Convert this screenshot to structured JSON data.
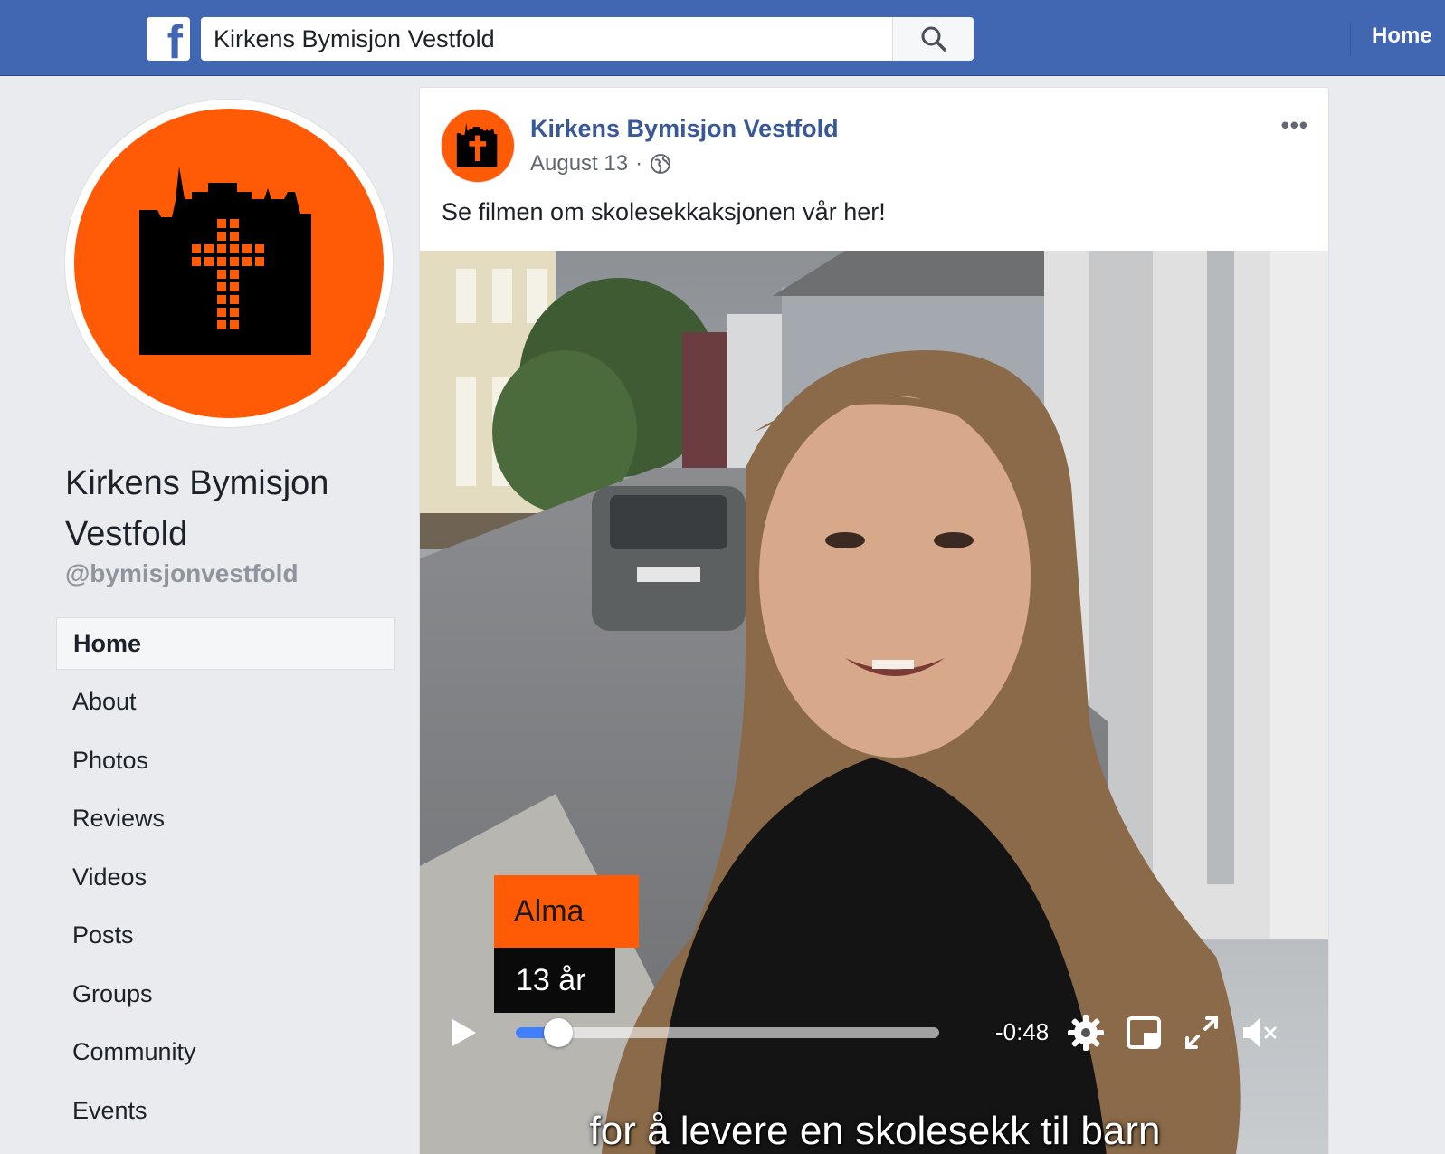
{
  "topbar": {
    "search_value": "Kirkens Bymisjon Vestfold",
    "home_label": "Home",
    "brand_color": "#4267b2"
  },
  "profile": {
    "name": "Kirkens Bymisjon Vestfold",
    "handle": "@bymisjonvestfold",
    "accent_color": "#ff5a05"
  },
  "nav": {
    "items": [
      {
        "label": "Home",
        "active": true
      },
      {
        "label": "About"
      },
      {
        "label": "Photos"
      },
      {
        "label": "Reviews"
      },
      {
        "label": "Videos"
      },
      {
        "label": "Posts"
      },
      {
        "label": "Groups"
      },
      {
        "label": "Community"
      },
      {
        "label": "Events"
      }
    ]
  },
  "post": {
    "author": "Kirkens Bymisjon Vestfold",
    "date": "August 13",
    "separator": "·",
    "privacy_icon": "globe-icon",
    "text": "Se filmen om skolesekkaksjonen vår her!",
    "more_icon": "more-options-icon"
  },
  "video": {
    "name_tag": "Alma",
    "age_tag": "13 år",
    "subtitle": "for å levere en skolesekk til barn",
    "time_remaining": "-0:48",
    "progress": 0.1,
    "icons": [
      "play-icon",
      "settings-icon",
      "picture-in-picture-icon",
      "fullscreen-icon",
      "mute-icon"
    ]
  }
}
